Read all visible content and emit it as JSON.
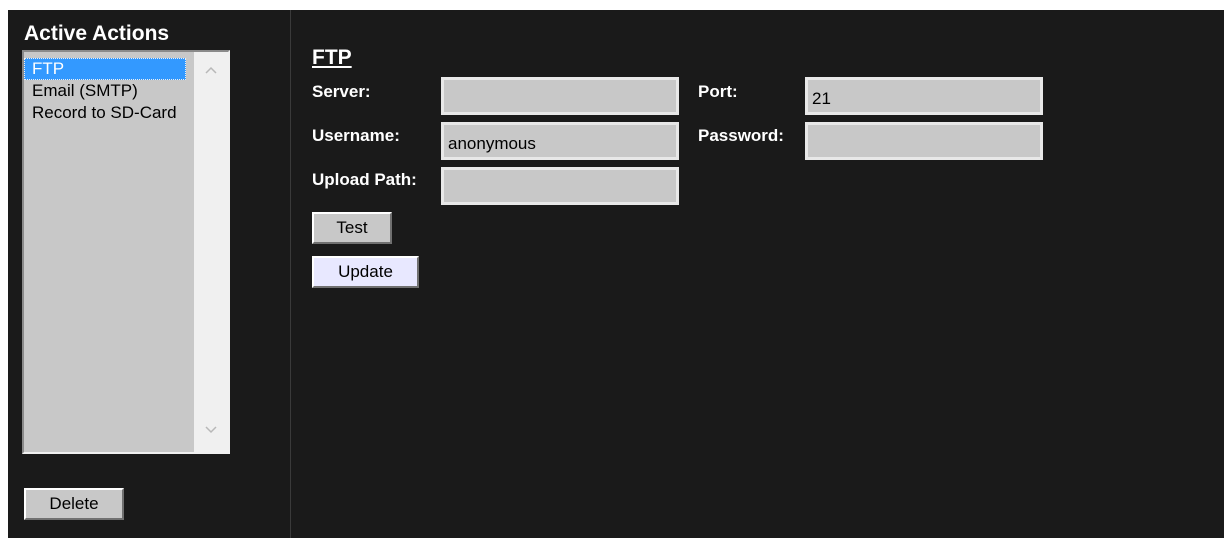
{
  "sidebar": {
    "title": "Active Actions",
    "items": [
      {
        "label": "FTP",
        "selected": true
      },
      {
        "label": "Email (SMTP)",
        "selected": false
      },
      {
        "label": "Record to SD-Card",
        "selected": false
      }
    ],
    "delete_label": "Delete"
  },
  "main": {
    "section_title": "FTP",
    "server": {
      "label": "Server:",
      "value": ""
    },
    "port": {
      "label": "Port:",
      "value": "21"
    },
    "username": {
      "label": "Username:",
      "value": "anonymous"
    },
    "password": {
      "label": "Password:",
      "value": ""
    },
    "upload_path": {
      "label": "Upload Path:",
      "value": ""
    },
    "test_label": "Test",
    "update_label": "Update"
  },
  "colors": {
    "background": "#1a1a1a",
    "selection": "#3399ff",
    "field": "#c8c8c8"
  }
}
